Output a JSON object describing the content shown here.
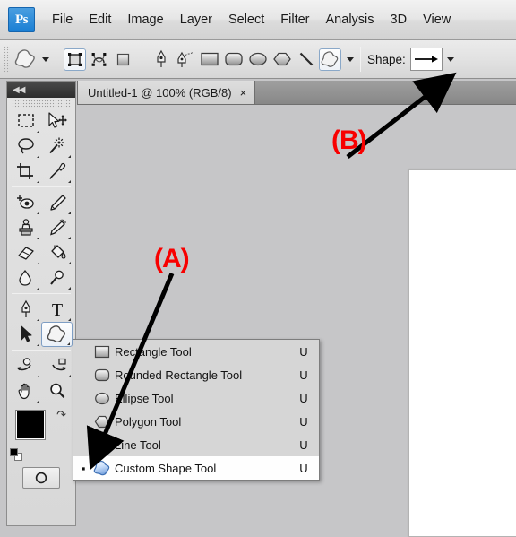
{
  "app": {
    "logo_text": "Ps",
    "background_color": "#c6c6c8",
    "accent_color": "#f80000"
  },
  "menubar": {
    "items": [
      {
        "label": "File"
      },
      {
        "label": "Edit"
      },
      {
        "label": "Image"
      },
      {
        "label": "Layer"
      },
      {
        "label": "Select"
      },
      {
        "label": "Filter"
      },
      {
        "label": "Analysis"
      },
      {
        "label": "3D"
      },
      {
        "label": "View"
      }
    ]
  },
  "options_bar": {
    "tool_preset_icon": "custom-shape-icon",
    "mode_buttons": [
      {
        "name": "shape-layers",
        "selected": true
      },
      {
        "name": "paths",
        "selected": false
      },
      {
        "name": "fill-pixels",
        "selected": false
      }
    ],
    "tool_buttons": [
      {
        "name": "pen-tool",
        "selected": false
      },
      {
        "name": "freeform-pen-tool",
        "selected": false
      },
      {
        "name": "rectangle-tool",
        "selected": false
      },
      {
        "name": "rounded-rectangle-tool",
        "selected": false
      },
      {
        "name": "ellipse-tool",
        "selected": false
      },
      {
        "name": "polygon-tool",
        "selected": false
      },
      {
        "name": "line-tool",
        "selected": false
      },
      {
        "name": "custom-shape-tool",
        "selected": true
      }
    ],
    "shape_label": "Shape:",
    "shape_preview_glyph": "arrow-shape"
  },
  "document_tab": {
    "title": "Untitled-1 @ 100% (RGB/8)",
    "close_glyph": "×"
  },
  "toolbar": {
    "collapse_glyph": "◀◀",
    "tools": [
      {
        "name": "rectangular-marquee-tool",
        "has_flyout": true,
        "selected": false
      },
      {
        "name": "move-tool",
        "has_flyout": false,
        "selected": false
      },
      {
        "name": "lasso-tool",
        "has_flyout": true,
        "selected": false
      },
      {
        "name": "magic-wand-tool",
        "has_flyout": true,
        "selected": false
      },
      {
        "name": "crop-tool",
        "has_flyout": true,
        "selected": false
      },
      {
        "name": "eyedropper-tool",
        "has_flyout": true,
        "selected": false
      },
      {
        "name": "spot-healing-brush-tool",
        "has_flyout": true,
        "selected": false
      },
      {
        "name": "brush-tool",
        "has_flyout": true,
        "selected": false
      },
      {
        "name": "clone-stamp-tool",
        "has_flyout": true,
        "selected": false
      },
      {
        "name": "history-brush-tool",
        "has_flyout": true,
        "selected": false
      },
      {
        "name": "eraser-tool",
        "has_flyout": true,
        "selected": false
      },
      {
        "name": "paint-bucket-tool",
        "has_flyout": true,
        "selected": false
      },
      {
        "name": "blur-tool",
        "has_flyout": true,
        "selected": false
      },
      {
        "name": "dodge-tool",
        "has_flyout": true,
        "selected": false
      },
      {
        "name": "pen-tool",
        "has_flyout": true,
        "selected": false
      },
      {
        "name": "horizontal-type-tool",
        "has_flyout": true,
        "selected": false
      },
      {
        "name": "path-selection-tool",
        "has_flyout": true,
        "selected": false
      },
      {
        "name": "custom-shape-tool",
        "has_flyout": true,
        "selected": true
      },
      {
        "name": "3d-rotate-tool",
        "has_flyout": true,
        "selected": false
      },
      {
        "name": "3d-orbit-tool",
        "has_flyout": true,
        "selected": false
      },
      {
        "name": "hand-tool",
        "has_flyout": true,
        "selected": false
      },
      {
        "name": "zoom-tool",
        "has_flyout": false,
        "selected": false
      }
    ],
    "foreground_color": "#000000",
    "background_color": "#ffffff",
    "quick_mask_name": "edit-in-quick-mask-mode"
  },
  "flyout_menu": {
    "items": [
      {
        "icon": "rectangle-icon",
        "label": "Rectangle Tool",
        "shortcut": "U",
        "active": false
      },
      {
        "icon": "rounded-rectangle-icon",
        "label": "Rounded Rectangle Tool",
        "shortcut": "U",
        "active": false
      },
      {
        "icon": "ellipse-icon",
        "label": "Ellipse Tool",
        "shortcut": "U",
        "active": false
      },
      {
        "icon": "polygon-icon",
        "label": "Polygon Tool",
        "shortcut": "U",
        "active": false
      },
      {
        "icon": "line-icon",
        "label": "Line Tool",
        "shortcut": "U",
        "active": false
      },
      {
        "icon": "custom-shape-icon",
        "label": "Custom Shape Tool",
        "shortcut": "U",
        "active": true
      }
    ],
    "bullet_glyph": "▪"
  },
  "annotations": [
    {
      "label": "(A)",
      "target": "custom-shape-tool-in-flyout"
    },
    {
      "label": "(B)",
      "target": "shape-picker-in-options-bar"
    }
  ]
}
